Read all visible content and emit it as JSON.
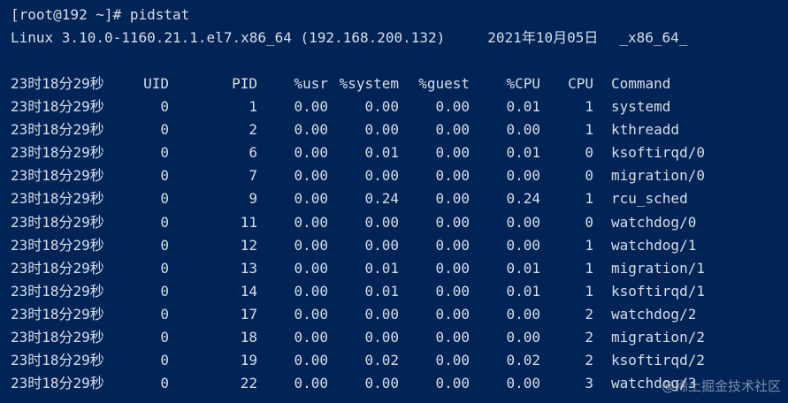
{
  "prompt": "[root@192 ~]# pidstat",
  "sysinfo": {
    "kernel": "Linux 3.10.0-1160.21.1.el7.x86_64 (192.168.200.132)",
    "date": "2021年10月05日",
    "arch": "_x86_64_"
  },
  "headers": {
    "time": "23时18分29秒",
    "uid": "UID",
    "pid": "PID",
    "usr": "%usr",
    "system": "%system",
    "guest": "%guest",
    "cpu_pct": "%CPU",
    "cpu": "CPU",
    "command": "Command"
  },
  "rows": [
    {
      "time": "23时18分29秒",
      "uid": "0",
      "pid": "1",
      "usr": "0.00",
      "system": "0.00",
      "guest": "0.00",
      "cpu_pct": "0.01",
      "cpu": "1",
      "command": "systemd"
    },
    {
      "time": "23时18分29秒",
      "uid": "0",
      "pid": "2",
      "usr": "0.00",
      "system": "0.00",
      "guest": "0.00",
      "cpu_pct": "0.00",
      "cpu": "1",
      "command": "kthreadd"
    },
    {
      "time": "23时18分29秒",
      "uid": "0",
      "pid": "6",
      "usr": "0.00",
      "system": "0.01",
      "guest": "0.00",
      "cpu_pct": "0.01",
      "cpu": "0",
      "command": "ksoftirqd/0"
    },
    {
      "time": "23时18分29秒",
      "uid": "0",
      "pid": "7",
      "usr": "0.00",
      "system": "0.00",
      "guest": "0.00",
      "cpu_pct": "0.00",
      "cpu": "0",
      "command": "migration/0"
    },
    {
      "time": "23时18分29秒",
      "uid": "0",
      "pid": "9",
      "usr": "0.00",
      "system": "0.24",
      "guest": "0.00",
      "cpu_pct": "0.24",
      "cpu": "1",
      "command": "rcu_sched"
    },
    {
      "time": "23时18分29秒",
      "uid": "0",
      "pid": "11",
      "usr": "0.00",
      "system": "0.00",
      "guest": "0.00",
      "cpu_pct": "0.00",
      "cpu": "0",
      "command": "watchdog/0"
    },
    {
      "time": "23时18分29秒",
      "uid": "0",
      "pid": "12",
      "usr": "0.00",
      "system": "0.00",
      "guest": "0.00",
      "cpu_pct": "0.00",
      "cpu": "1",
      "command": "watchdog/1"
    },
    {
      "time": "23时18分29秒",
      "uid": "0",
      "pid": "13",
      "usr": "0.00",
      "system": "0.01",
      "guest": "0.00",
      "cpu_pct": "0.01",
      "cpu": "1",
      "command": "migration/1"
    },
    {
      "time": "23时18分29秒",
      "uid": "0",
      "pid": "14",
      "usr": "0.00",
      "system": "0.01",
      "guest": "0.00",
      "cpu_pct": "0.01",
      "cpu": "1",
      "command": "ksoftirqd/1"
    },
    {
      "time": "23时18分29秒",
      "uid": "0",
      "pid": "17",
      "usr": "0.00",
      "system": "0.00",
      "guest": "0.00",
      "cpu_pct": "0.00",
      "cpu": "2",
      "command": "watchdog/2"
    },
    {
      "time": "23时18分29秒",
      "uid": "0",
      "pid": "18",
      "usr": "0.00",
      "system": "0.00",
      "guest": "0.00",
      "cpu_pct": "0.00",
      "cpu": "2",
      "command": "migration/2"
    },
    {
      "time": "23时18分29秒",
      "uid": "0",
      "pid": "19",
      "usr": "0.00",
      "system": "0.02",
      "guest": "0.00",
      "cpu_pct": "0.02",
      "cpu": "2",
      "command": "ksoftirqd/2"
    },
    {
      "time": "23时18分29秒",
      "uid": "0",
      "pid": "22",
      "usr": "0.00",
      "system": "0.00",
      "guest": "0.00",
      "cpu_pct": "0.00",
      "cpu": "3",
      "command": "watchdog/3"
    }
  ],
  "watermark": "@稀土掘金技术社区",
  "colors": {
    "background": "#012456",
    "foreground": "#d9dee8"
  }
}
